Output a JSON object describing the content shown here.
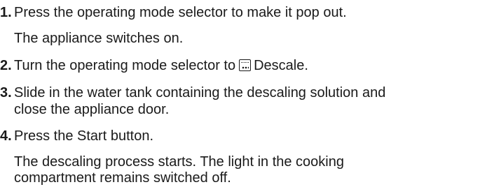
{
  "steps": [
    {
      "number": "1.",
      "lines": [
        "Press the operating mode selector to make it pop out.",
        "The appliance switches on."
      ]
    },
    {
      "number": "2.",
      "text_before_icon": "Turn the operating mode selector to",
      "icon": "descale-icon",
      "text_after_icon": "Descale."
    },
    {
      "number": "3.",
      "lines": [
        "Slide in the water tank containing the descaling solution and",
        "close the appliance door."
      ]
    },
    {
      "number": "4.",
      "lines": [
        "Press the Start button.",
        "The descaling process starts. The light in the cooking",
        "compartment remains switched off."
      ]
    }
  ]
}
